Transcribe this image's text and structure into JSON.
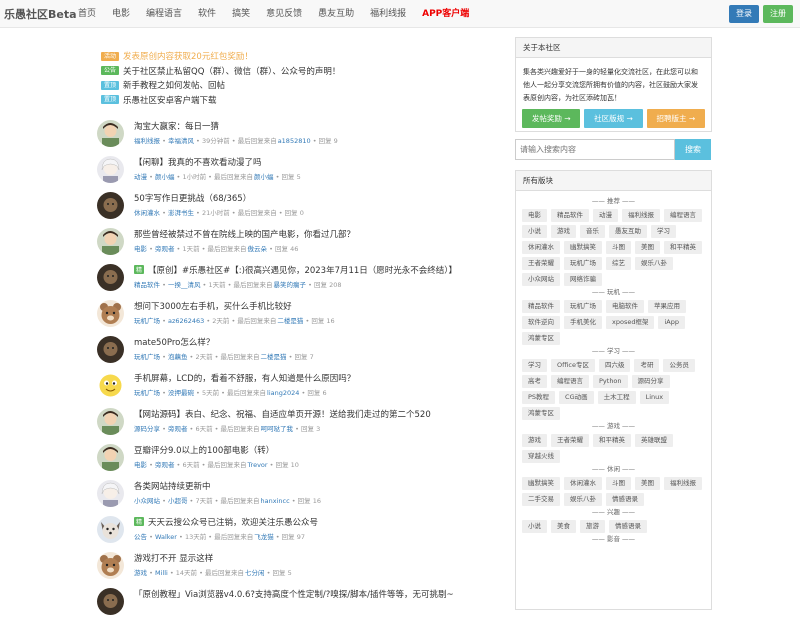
{
  "nav": {
    "brand": "乐愚社区Beta",
    "links": [
      "首页",
      "电影",
      "编程语言",
      "软件",
      "搞笑",
      "意见反馈",
      "愚友互助",
      "福利线报",
      "APP客户端"
    ],
    "login": "登录",
    "register": "注册"
  },
  "notices": [
    {
      "tag": "活动",
      "tag_color": "#f0ad4e",
      "text": "发表原创内容获取20元红包奖励！",
      "text_color": "#f0ad4e"
    },
    {
      "tag": "公告",
      "tag_color": "#5cb85c",
      "text": "关于社区禁止私留QQ（群）、微信（群）、公众号的声明！",
      "text_color": "#333333"
    },
    {
      "tag": "置顶",
      "tag_color": "#5bc0de",
      "text": "新手教程之如何发帖、回帖",
      "text_color": "#333333"
    },
    {
      "tag": "置顶",
      "tag_color": "#5bc0de",
      "text": "乐愚社区安卓客户端下载",
      "text_color": "#333333"
    }
  ],
  "feed": [
    {
      "title": "淘宝大赢家：每日一猜",
      "hot": "",
      "board": "福利线报",
      "author": "幸福清风",
      "time": "39分钟前",
      "reply_user": "a1852810",
      "replies": "回复 9",
      "avatar": "cartoon"
    },
    {
      "title": "【闲聊】我真的不喜欢看动漫了吗",
      "hot": "",
      "board": "动漫",
      "author": "颜小蝠",
      "time": "1小时前",
      "reply_user": "颜小蝠",
      "replies": "回复 5",
      "avatar": "anime-white"
    },
    {
      "title": "50字写作日更挑战（68/365）",
      "hot": "",
      "board": "休闲灌水",
      "author": "澎湃书生",
      "time": "21小时前",
      "reply_user": "",
      "replies": "回复 0",
      "avatar": "dark"
    },
    {
      "title": "那些曾经被禁过不曾在院线上映的国产电影，你看过几部？",
      "hot": "",
      "board": "电影",
      "author": "旁观者",
      "time": "1天前",
      "reply_user": "傲云朵",
      "replies": "回复 46",
      "avatar": "cartoon"
    },
    {
      "title": "【原创】#乐愚社区#【:)很高兴遇见你，2023年7月11日（愿时光永不会终结）】",
      "hot": "精",
      "board": "精品软件",
      "author": "一揆__清风",
      "time": "1天前",
      "reply_user": "暴笑的瘸子",
      "replies": "回复 208",
      "avatar": "dark"
    },
    {
      "title": "想问下3000左右手机，买什么手机比较好",
      "hot": "",
      "board": "玩机广场",
      "author": "az6262463",
      "time": "2天前",
      "reply_user": "二楼是猫",
      "replies": "回复 16",
      "avatar": "bear"
    },
    {
      "title": "mate50Pro怎么样？",
      "hot": "",
      "board": "玩机广场",
      "author": "泡藕鱼",
      "time": "2天前",
      "reply_user": "二楼是猫",
      "replies": "回复 7",
      "avatar": "dark"
    },
    {
      "title": "手机屏幕，LCD的，看着不舒服，有人知道是什么原因吗？",
      "hot": "",
      "board": "玩机广场",
      "author": "没押最碗",
      "time": "5天前",
      "reply_user": "liang2024",
      "replies": "回复 6",
      "avatar": "emoji"
    },
    {
      "title": "【网站源码】表白、纪念、祝福、自适应单页开源！送给我们走过的第二个520",
      "hot": "",
      "board": "源码分享",
      "author": "旁观者",
      "time": "6天前",
      "reply_user": "呵呵哒了我",
      "replies": "回复 3",
      "avatar": "cartoon"
    },
    {
      "title": "豆瓣评分9.0以上的100部电影（转）",
      "hot": "",
      "board": "电影",
      "author": "旁观者",
      "time": "6天前",
      "reply_user": "Trevor",
      "replies": "回复 10",
      "avatar": "cartoon"
    },
    {
      "title": "各类网站持续更新中",
      "hot": "",
      "board": "小众网站",
      "author": "小超哥",
      "time": "7天前",
      "reply_user": "hanxincc",
      "replies": "回复 16",
      "avatar": "anime-white"
    },
    {
      "title": "天天云搜公众号已注销，欢迎关注乐愚公众号",
      "hot": "精",
      "board": "公告",
      "author": "Walker",
      "time": "13天前",
      "reply_user": "飞龙猫",
      "replies": "回复 97",
      "avatar": "dog"
    },
    {
      "title": "游戏打不开 显示这样",
      "hot": "",
      "board": "游戏",
      "author": "Milli",
      "time": "14天前",
      "reply_user": "七分闲",
      "replies": "回复 5",
      "avatar": "bear"
    },
    {
      "title": "「原创教程」Via浏览器v4.0.6?支持高度个性定制/?嗅探/脚本/插件等等，无可挑剔~",
      "hot": "",
      "board": "",
      "author": "",
      "time": "",
      "reply_user": "",
      "replies": "",
      "avatar": "dark"
    }
  ],
  "meta_labels": {
    "last_reply": "最后回复来自"
  },
  "about": {
    "header": "关于本社区",
    "text": "集各类兴趣爱好于一身的轻量化交流社区，在此您可以和他人一起分享交流您所拥有价值的内容，社区鼓励大家发表原创内容，为社区添砖加瓦！",
    "buttons": [
      {
        "label": "发帖奖励 →",
        "color": "#5cb85c"
      },
      {
        "label": "社区版规 →",
        "color": "#5bc0de"
      },
      {
        "label": "招聘版主 →",
        "color": "#f0ad4e"
      }
    ]
  },
  "search": {
    "placeholder": "请输入搜索内容",
    "button": "搜索"
  },
  "boards": {
    "header": "所有版块",
    "sections": [
      {
        "name": "—— 推荐 ——",
        "items": [
          "电影",
          "精品软件",
          "动漫",
          "福利线报",
          "编程语言",
          "小说",
          "游戏",
          "音乐",
          "愚友互助",
          "学习",
          "休闲灌水",
          "幽默搞笑",
          "斗图",
          "美图",
          "和平精英",
          "王者荣耀",
          "玩机广场",
          "综艺",
          "娱乐八卦",
          "小众网站",
          "网络诈骗"
        ]
      },
      {
        "name": "—— 玩机 ——",
        "items": [
          "精品软件",
          "玩机广场",
          "电脑软件",
          "苹果应用",
          "软件逆向",
          "手机美化",
          "xposed框架",
          "iApp",
          "鸿蒙专区"
        ]
      },
      {
        "name": "—— 学习 ——",
        "items": [
          "学习",
          "Office专区",
          "四六级",
          "考研",
          "公务员",
          "高考",
          "编程语言",
          "Python",
          "源码分享",
          "PS教程",
          "CG动画",
          "土木工程",
          "Linux",
          "鸿蒙专区"
        ]
      },
      {
        "name": "—— 游戏 ——",
        "items": [
          "游戏",
          "王者荣耀",
          "和平精英",
          "英雄联盟",
          "穿越火线"
        ]
      },
      {
        "name": "—— 休闲 ——",
        "items": [
          "幽默搞笑",
          "休闲灌水",
          "斗图",
          "美图",
          "福利线报",
          "二手交易",
          "娱乐八卦",
          "情感语录"
        ]
      },
      {
        "name": "—— 兴趣 ——",
        "items": [
          "小说",
          "美食",
          "旅游",
          "情感语录"
        ]
      },
      {
        "name": "—— 影音 ——",
        "items": []
      }
    ]
  }
}
